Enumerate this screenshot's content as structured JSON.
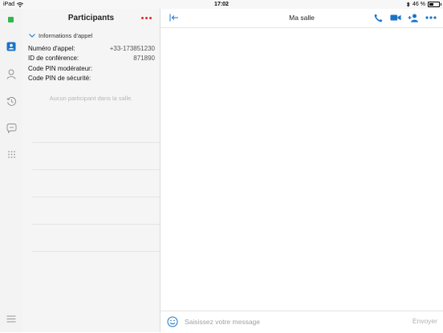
{
  "status_bar": {
    "device": "iPad",
    "time": "17:02",
    "battery": "46 %",
    "battery_level_pct": 46
  },
  "rail": {
    "items": [
      {
        "icon": "contacts-card-icon",
        "active": true
      },
      {
        "icon": "person-icon",
        "active": false
      },
      {
        "icon": "recent-history-icon",
        "active": false
      },
      {
        "icon": "chat-bubble-icon",
        "active": false
      },
      {
        "icon": "dialpad-icon",
        "active": false
      }
    ],
    "menu_icon": "hamburger-menu-icon"
  },
  "participants": {
    "title": "Participants",
    "section_label": "Informations d'appel",
    "info": [
      {
        "label": "Numéro d'appel:",
        "value": "+33-173851230"
      },
      {
        "label": "ID de conférence:",
        "value": "871890"
      },
      {
        "label": "Code PIN modérateur:",
        "value": ""
      },
      {
        "label": "Code PIN de sécurité:",
        "value": ""
      }
    ],
    "empty_message": "Aucun participant dans la salle."
  },
  "conversation": {
    "title": "Ma salle",
    "header_icons": [
      "phone-icon",
      "video-camera-icon",
      "add-person-icon",
      "more-icon"
    ]
  },
  "composer": {
    "placeholder": "Saisissez votre message",
    "send_label": "Envoyer"
  },
  "colors": {
    "accent": "#1a73c8",
    "presence": "#2fb94a",
    "alert": "#e5282b"
  }
}
